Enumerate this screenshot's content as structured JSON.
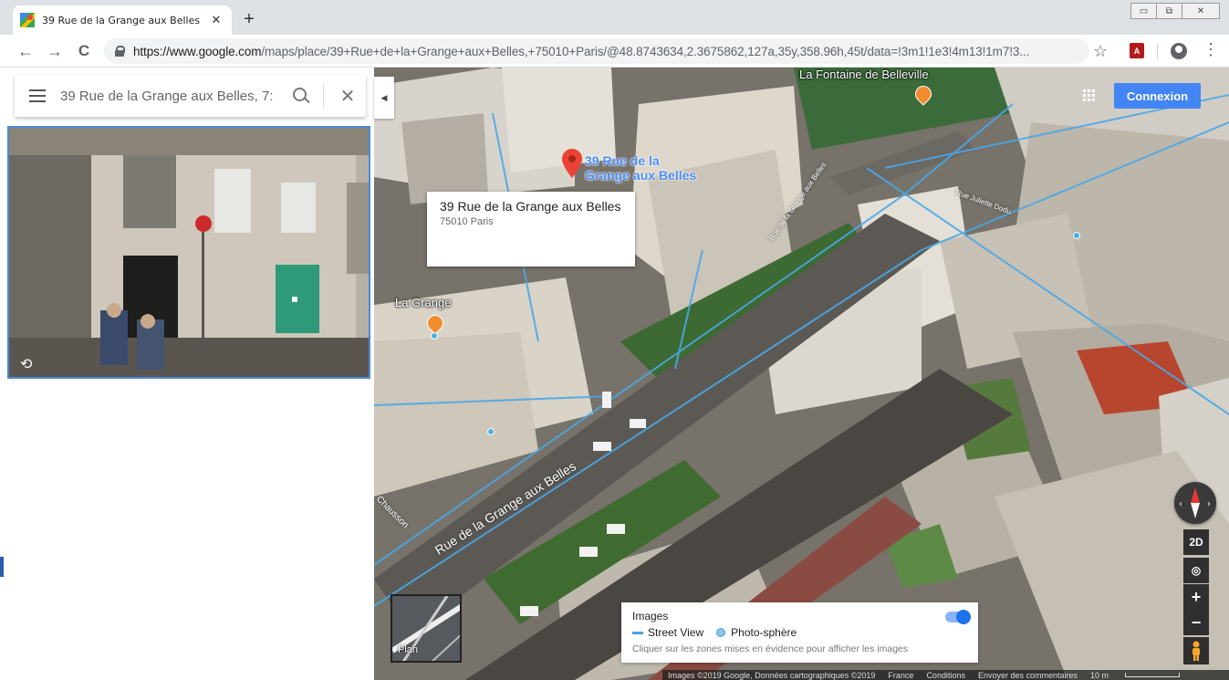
{
  "browser": {
    "tab_title": "39 Rue de la Grange aux Belles - Goo",
    "tab_close": "✕",
    "new_tab": "+",
    "back": "←",
    "forward": "→",
    "reload": "C",
    "url_host": "https://www.google.com",
    "url_path": "/maps/place/39+Rue+de+la+Grange+aux+Belles,+75010+Paris/@48.8743634,2.3675862,127a,35y,358.96h,45t/data=!3m1!1e3!4m13!1m7!3...",
    "star": "☆",
    "menu": "⋮"
  },
  "sidebar": {
    "search_value": "39 Rue de la Grange aux Belles, 7:",
    "clear": "✕"
  },
  "map": {
    "collapse_arrow": "◀",
    "connexion_label": "Connexion",
    "pin_label_line1": "39 Rue de la",
    "pin_label_line2": "Grange aux Belles",
    "poi_fontaine": "La Fontaine de Belleville",
    "poi_grange": "La Grange",
    "street_main": "Rue de la Grange aux Belles",
    "street_small": "Rue de la Grange aux Belles",
    "street_chausson": "Chausson",
    "street_dieu": "Rue Juliette Dodu"
  },
  "info_card": {
    "title": "39 Rue de la Grange aux Belles",
    "subtitle": "75010 Paris"
  },
  "controls": {
    "view_2d": "2D",
    "zoom_in": "+",
    "zoom_out": "−"
  },
  "plan_thumb": {
    "label": "Plan"
  },
  "images_panel": {
    "title": "Images",
    "street_view": "Street View",
    "photo_sphere": "Photo-sphère",
    "hint": "Cliquer sur les zones mises en évidence pour afficher les images"
  },
  "footer": {
    "attribution": "Images ©2019 Google, Données cartographiques ©2019",
    "country": "France",
    "conditions": "Conditions",
    "feedback": "Envoyer des commentaires",
    "scale": "10 m"
  }
}
